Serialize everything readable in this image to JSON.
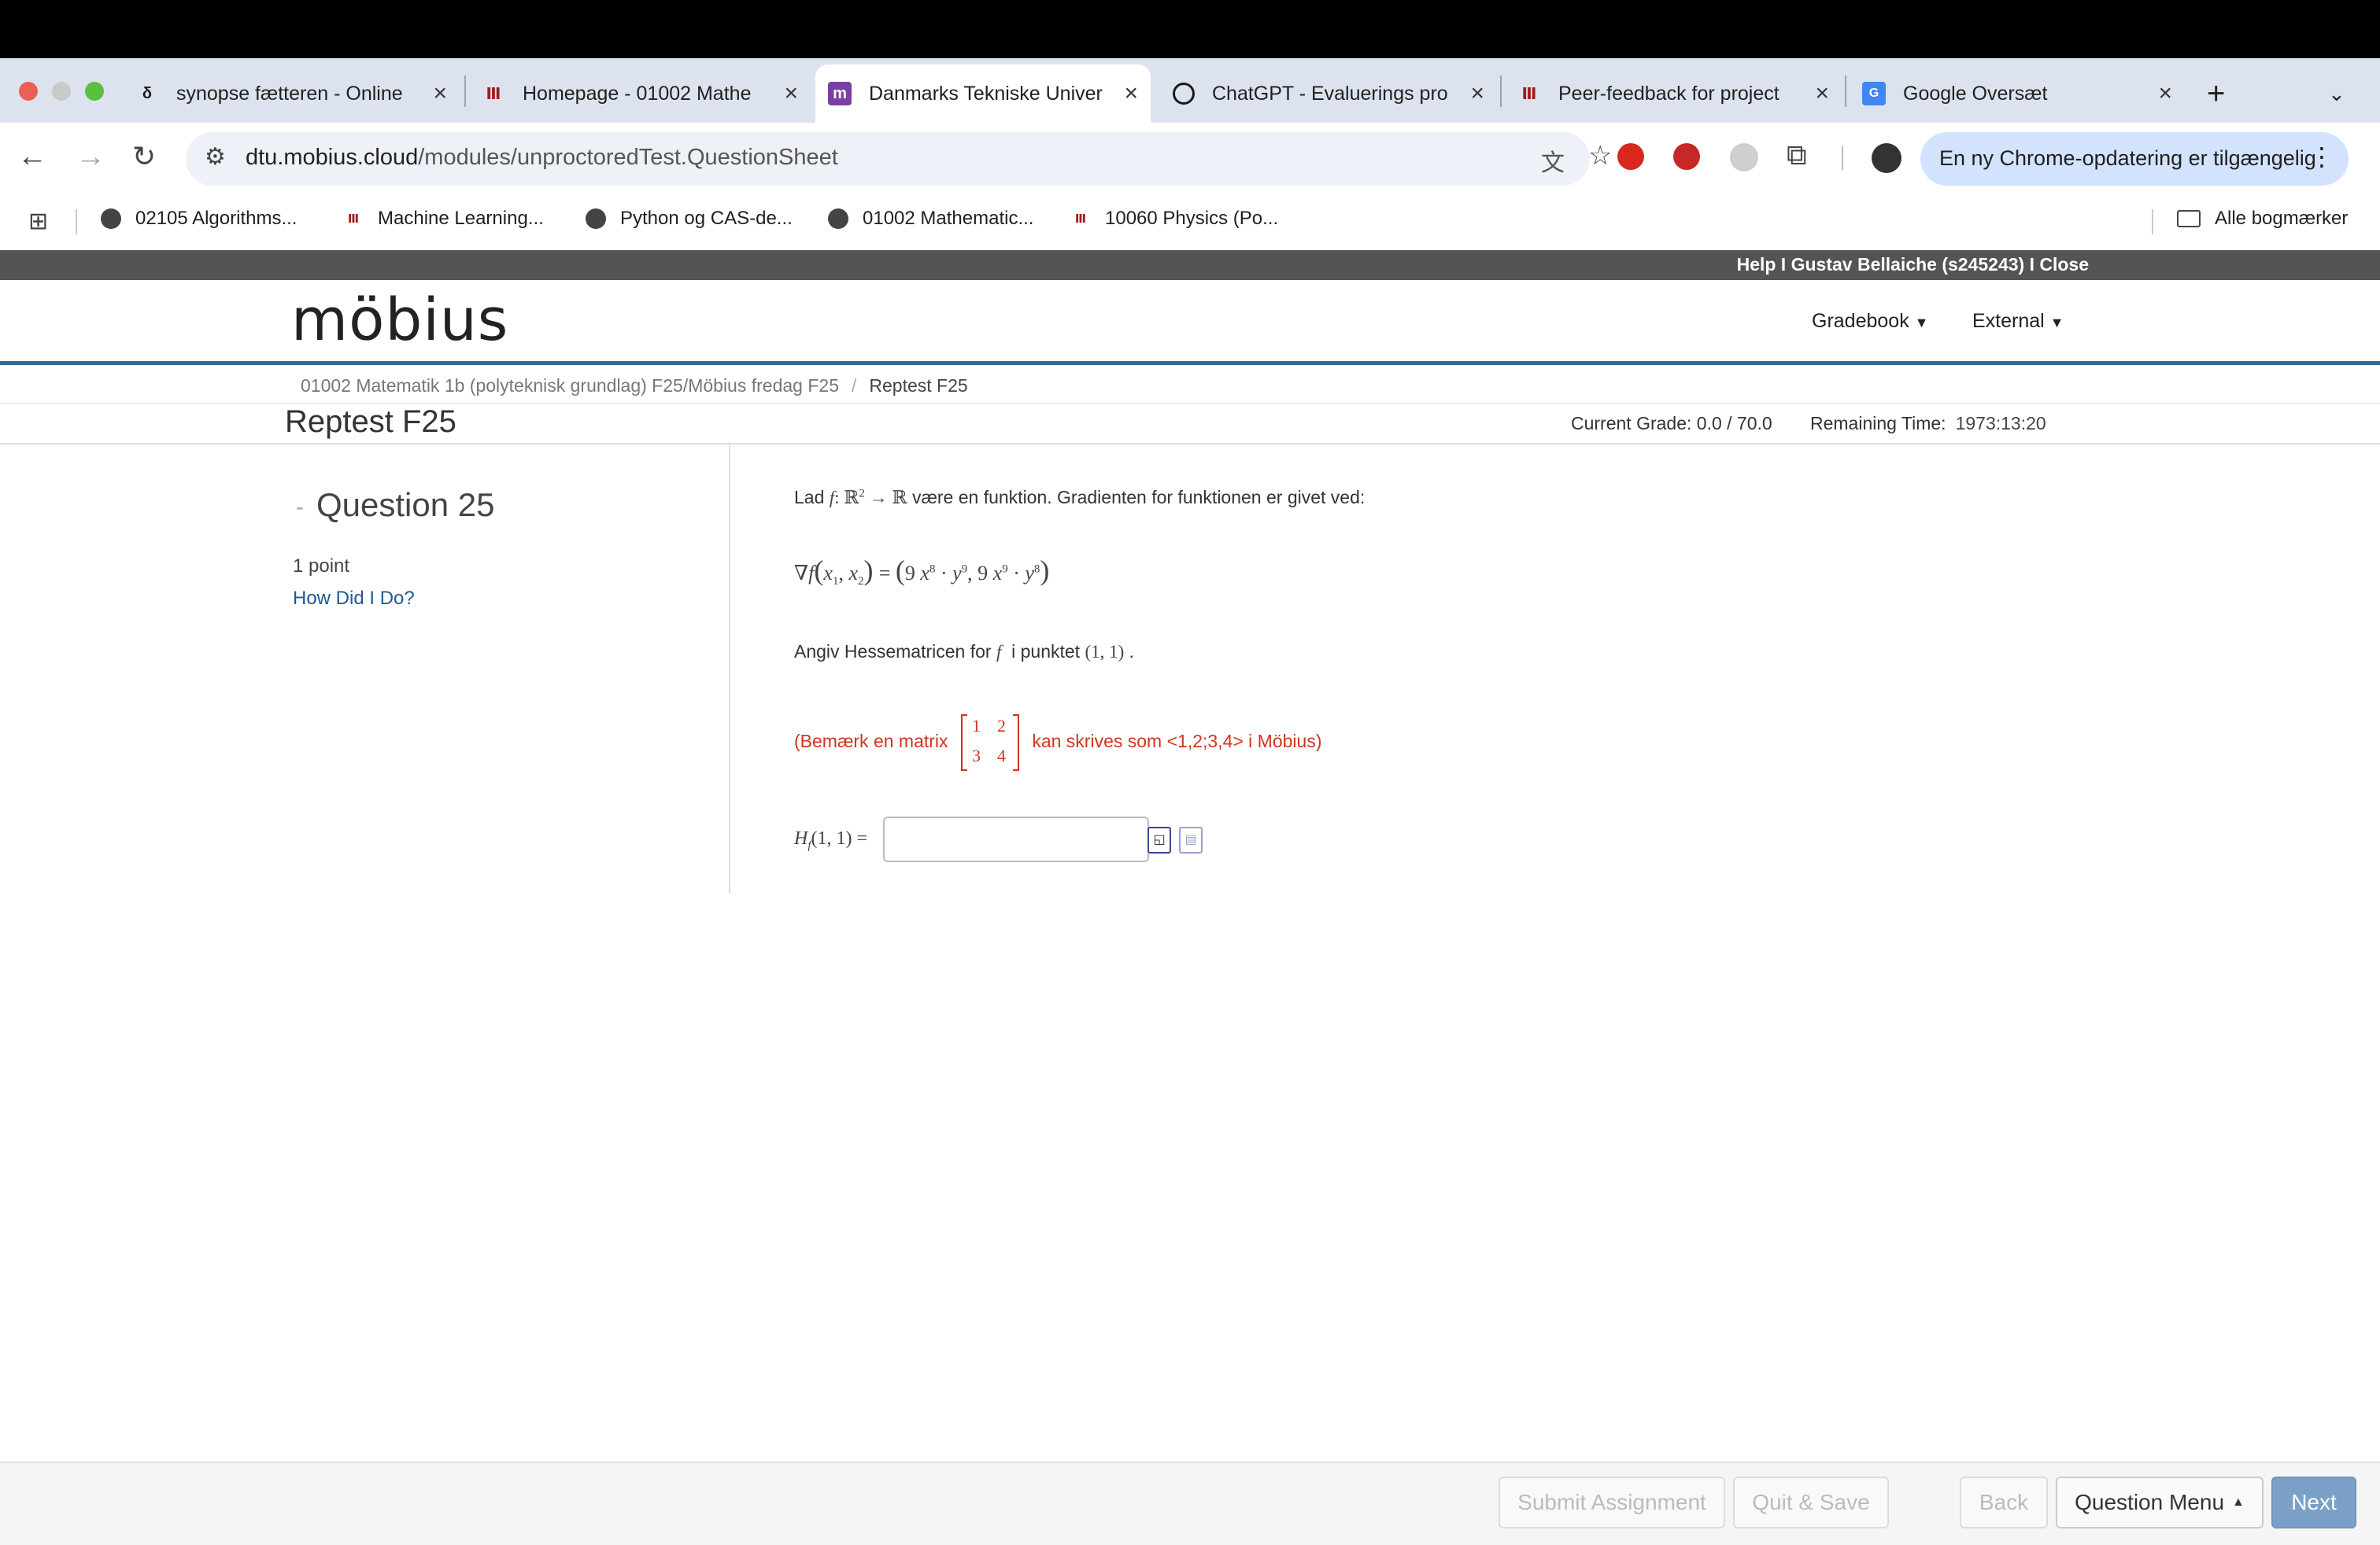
{
  "browser": {
    "tabs": [
      {
        "title": "synopse fætteren - Online",
        "icon": "grammarly-icon"
      },
      {
        "title": "Homepage - 01002 Mathe",
        "icon": "dtu-icon"
      },
      {
        "title": "Danmarks Tekniske Univer",
        "icon": "mobius-icon",
        "active": true
      },
      {
        "title": "ChatGPT - Evaluerings pro",
        "icon": "chatgpt-icon"
      },
      {
        "title": "Peer-feedback for project",
        "icon": "dtu-icon"
      },
      {
        "title": "Google Oversæt",
        "icon": "google-translate-icon"
      }
    ],
    "new_tab": "+",
    "url_host": "dtu.mobius.cloud",
    "url_path": "/modules/unproctoredTest.QuestionSheet",
    "update_label": "En ny Chrome-opdatering er tilgængelig",
    "bookmarks": [
      {
        "label": "02105 Algorithms...",
        "icon": "globe-icon"
      },
      {
        "label": "Machine Learning...",
        "icon": "dtu-icon"
      },
      {
        "label": "Python og CAS-de...",
        "icon": "globe-icon"
      },
      {
        "label": "01002 Mathematic...",
        "icon": "globe-icon"
      },
      {
        "label": "10060 Physics (Po...",
        "icon": "dtu-icon"
      }
    ],
    "all_bookmarks": "Alle bogmærker"
  },
  "mobius": {
    "topbar": "Help I Gustav Bellaiche (s245243) I Close",
    "logo": "möbius",
    "nav": [
      "Gradebook",
      "External"
    ],
    "breadcrumb": [
      "01002 Matematik 1b (polyteknisk grundlag) F25/Möbius fredag F25",
      "Reptest F25"
    ],
    "page_title": "Reptest F25",
    "current_grade": "Current Grade: 0.0 / 70.0",
    "remaining_label": "Remaining Time:",
    "remaining_value": "1973:13:20"
  },
  "question": {
    "label": "Question 25",
    "points": "1 point",
    "how_did_i_do": "How Did I Do?",
    "intro_prefix": "Lad",
    "intro_suffix": "være en funktion. Gradienten for funktionen er givet ved:",
    "prompt_prefix": "Angiv Hessematricen for",
    "prompt_mid": "i punktet",
    "point": "(1, 1)",
    "note_prefix": "(Bemærk en matrix",
    "note_suffix": "kan skrives som <1,2;3,4>  i Möbius)",
    "matrix": [
      "1",
      "2",
      "3",
      "4"
    ],
    "answer_label": "=",
    "answer_value": ""
  },
  "footer": {
    "submit": "Submit Assignment",
    "quit": "Quit & Save",
    "back": "Back",
    "menu": "Question Menu",
    "next": "Next"
  },
  "colors": {
    "accent": "#2f6f91",
    "note": "#d0351d",
    "next": "#7aa0c8",
    "link": "#1f5a92"
  }
}
